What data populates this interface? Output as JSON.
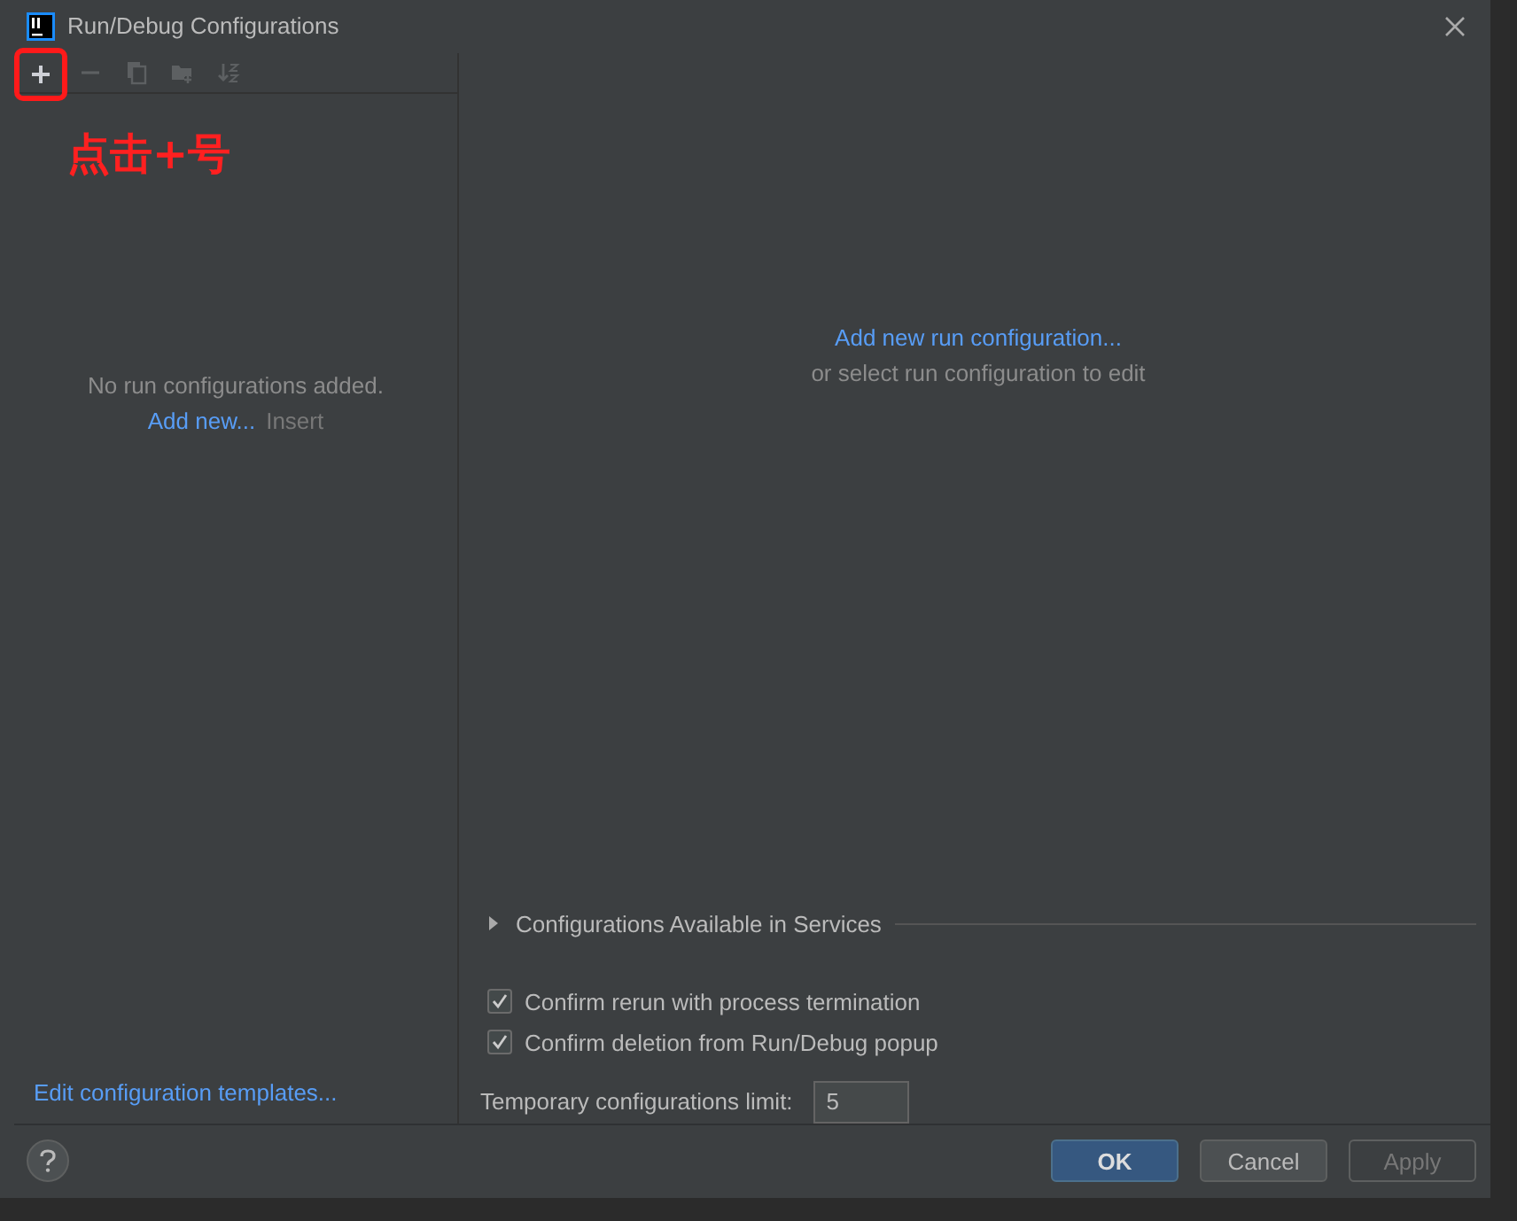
{
  "window": {
    "title": "Run/Debug Configurations"
  },
  "toolbar": [
    {
      "kind": "add",
      "disabled": false,
      "highlighted": true
    },
    {
      "kind": "remove",
      "disabled": true,
      "highlighted": false
    },
    {
      "kind": "copy",
      "disabled": true,
      "highlighted": false
    },
    {
      "kind": "folder",
      "disabled": true,
      "highlighted": false
    },
    {
      "kind": "sort",
      "disabled": true,
      "highlighted": false
    }
  ],
  "annotation": {
    "text": "点击+号"
  },
  "left_panel": {
    "empty_message": "No run configurations added.",
    "add_link": "Add new...",
    "shortcut": "Insert",
    "templates_link": "Edit configuration templates..."
  },
  "right_panel": {
    "add_link": "Add new run configuration...",
    "hint": "or select run configuration to edit",
    "services": {
      "label": "Configurations Available in Services",
      "expanded": false
    },
    "options": [
      {
        "label": "Confirm rerun with process termination",
        "checked": true
      },
      {
        "label": "Confirm deletion from Run/Debug popup",
        "checked": true
      }
    ],
    "limit": {
      "label": "Temporary configurations limit:",
      "value": "5"
    }
  },
  "footer": {
    "buttons": [
      {
        "label": "OK",
        "kind": "primary",
        "disabled": false
      },
      {
        "label": "Cancel",
        "kind": "normal",
        "disabled": false
      },
      {
        "label": "Apply",
        "kind": "normal",
        "disabled": true
      }
    ]
  }
}
